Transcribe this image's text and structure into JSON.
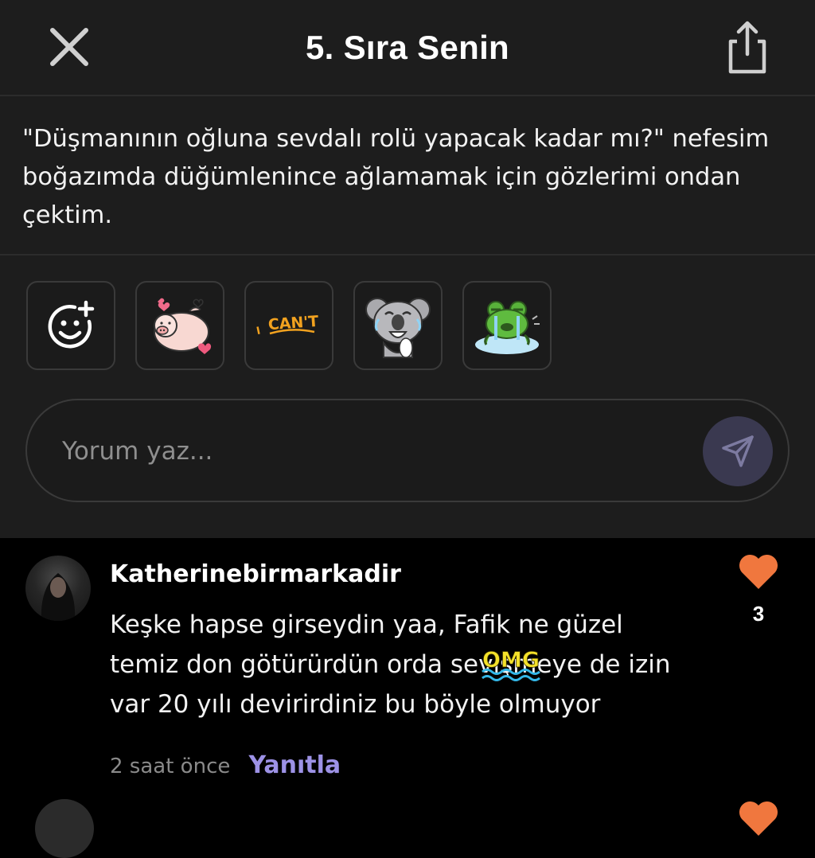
{
  "header": {
    "title": "5. Sıra Senin",
    "close_icon": "close-icon",
    "share_icon": "share-icon"
  },
  "quote": {
    "text": "\"Düşmanının oğluna sevdalı rolü yapacak kadar mı?\" nefesim boğazımda düğümlenince ağlamamak için gözlerimi ondan çektim."
  },
  "composer": {
    "stickers": [
      {
        "icon": "add-emoji-icon"
      },
      {
        "icon": "pig-hearts-sticker"
      },
      {
        "icon": "i-cant-sticker",
        "text": "I CAN'T"
      },
      {
        "icon": "laughing-koala-sticker"
      },
      {
        "icon": "crying-frog-sticker"
      }
    ],
    "placeholder": "Yorum yaz...",
    "send_icon": "send-icon"
  },
  "comments": [
    {
      "username": "Katherinebirmarkadir",
      "text": "Keşke hapse girseydin yaa, Fafik ne güzel temiz don götürürdün orda sevişmeye de izin var 20 yılı devirirdiniz bu böyle olmuyor",
      "overlay_sticker": "OMG",
      "time": "2 saat önce",
      "reply_label": "Yanıtla",
      "likes": "3",
      "like_icon": "heart-icon"
    }
  ],
  "colors": {
    "background": "#000000",
    "panel": "#1d1d1d",
    "accent_reply": "#9d92e6",
    "heart": "#f0773e",
    "send_button": "#3a3950"
  }
}
